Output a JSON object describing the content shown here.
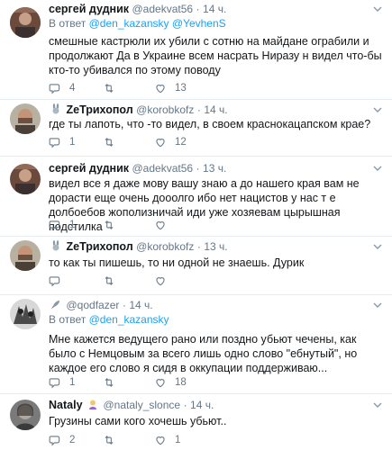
{
  "tweets": [
    {
      "name": "сергей дудник",
      "handle": "@adekvat56",
      "time": "14 ч.",
      "reply_prefix": "В ответ",
      "reply_to_1": "@den_kazansky",
      "reply_to_2": "@YevhenS",
      "text": "смешные кастрюли их убили с сотню на майдане ограбили и продолжают Да в Украине всем насрать   Ниразу н видел что-бы кто-то убивался по этому поводу",
      "replies": "4",
      "retweets": "",
      "likes": "13"
    },
    {
      "name": "ZeТрихопол",
      "handle": "@korobkofz",
      "time": "14 ч.",
      "text": "где ты лапоть, что -то видел, в своем краснокацапском крае?",
      "replies": "1",
      "retweets": "",
      "likes": "12"
    },
    {
      "name": "сергей дудник",
      "handle": "@adekvat56",
      "time": "13 ч.",
      "text": "видел все я даже мову вашу знаю а до нашего края вам не дорасти еще очень дооолго ибо нет нацистов у нас т е долбоебов жополизничай иди уже хозяевам цырышная подстилка",
      "replies": "1",
      "retweets": "",
      "likes": ""
    },
    {
      "name": "ZeТрихопол",
      "handle": "@korobkofz",
      "time": "13 ч.",
      "text": "то как  ты пишешь, то ни одной не знаешь. Дурик",
      "replies": "",
      "retweets": "",
      "likes": ""
    },
    {
      "name": "",
      "handle": "@qodfazer",
      "time": "14 ч.",
      "reply_prefix": "В ответ",
      "reply_to_1": "@den_kazansky",
      "text": "Мне кажется ведущего рано или поздно убьют чечены, как было с Немцовым за всего лишь одно слово \"ебнутый\", но каждое его слово я сидя в оккупации поддерживаю...",
      "replies": "1",
      "retweets": "",
      "likes": "18"
    },
    {
      "name": "Nataly",
      "handle": "@nataly_slonce",
      "time": "14 ч.",
      "text": "Грузины сами кого хочешь убьют..",
      "replies": "2",
      "retweets": "",
      "likes": "1"
    }
  ],
  "separator": "·",
  "icons": [
    "reply-icon",
    "retweet-icon",
    "like-icon",
    "chevron-down-icon",
    "rabbit-emoji-icon",
    "rocket-emoji-icon",
    "woman-emoji-icon"
  ]
}
